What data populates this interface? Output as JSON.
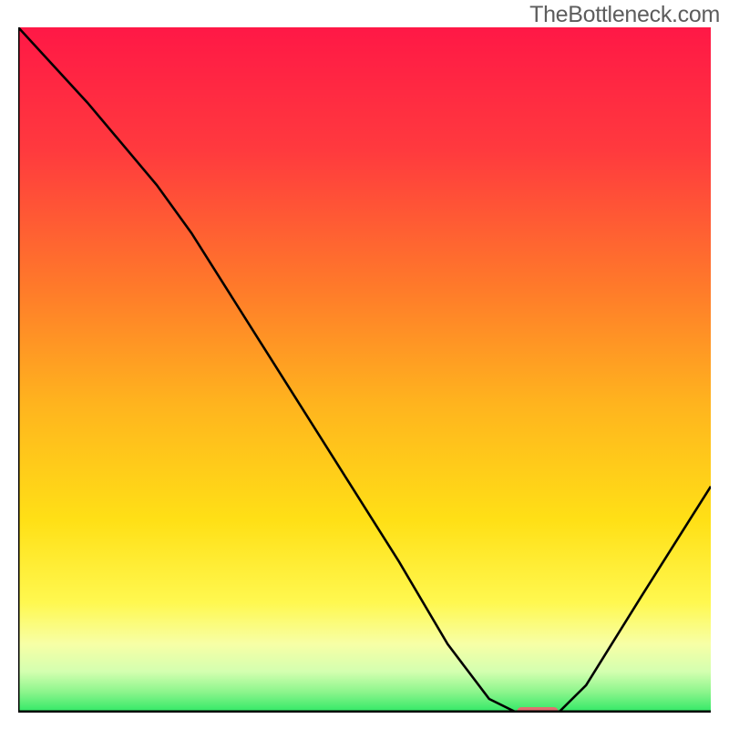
{
  "watermark": "TheBottleneck.com",
  "chart_data": {
    "type": "line",
    "title": "",
    "xlabel": "",
    "ylabel": "",
    "xlim": [
      0,
      100
    ],
    "ylim": [
      0,
      100
    ],
    "series": [
      {
        "name": "bottleneck-curve",
        "comment": "normalized: x 0-100 across plot width, y 0 at bottom axis, 100 at top; values are visual estimates from the rendered figure",
        "points": [
          {
            "x": 0,
            "y": 100
          },
          {
            "x": 10,
            "y": 89
          },
          {
            "x": 20,
            "y": 77
          },
          {
            "x": 25,
            "y": 70
          },
          {
            "x": 35,
            "y": 54
          },
          {
            "x": 45,
            "y": 38
          },
          {
            "x": 55,
            "y": 22
          },
          {
            "x": 62,
            "y": 10
          },
          {
            "x": 68,
            "y": 2
          },
          {
            "x": 72,
            "y": 0
          },
          {
            "x": 78,
            "y": 0
          },
          {
            "x": 82,
            "y": 4
          },
          {
            "x": 90,
            "y": 17
          },
          {
            "x": 100,
            "y": 33
          }
        ]
      }
    ],
    "marker": {
      "name": "optimal-range",
      "x_start": 72,
      "x_end": 78,
      "y": 0,
      "color": "#e07070"
    },
    "axis_color": "#000000",
    "curve_color": "#000000",
    "gradient_stops": [
      {
        "pos": 0.0,
        "color": "#ff1846"
      },
      {
        "pos": 0.18,
        "color": "#ff3a3e"
      },
      {
        "pos": 0.38,
        "color": "#ff7a2a"
      },
      {
        "pos": 0.55,
        "color": "#ffb41e"
      },
      {
        "pos": 0.72,
        "color": "#ffe016"
      },
      {
        "pos": 0.84,
        "color": "#fff850"
      },
      {
        "pos": 0.9,
        "color": "#f7ffa6"
      },
      {
        "pos": 0.94,
        "color": "#d4ffb0"
      },
      {
        "pos": 0.97,
        "color": "#8cf58c"
      },
      {
        "pos": 1.0,
        "color": "#2ee865"
      }
    ]
  }
}
